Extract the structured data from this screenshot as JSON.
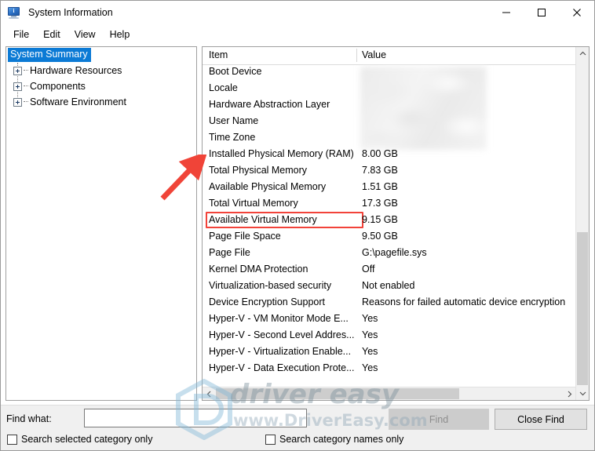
{
  "window": {
    "title": "System Information",
    "icon": "computer-monitor-icon",
    "controls": {
      "minimize": "minimize-icon",
      "maximize": "maximize-icon",
      "close": "close-icon"
    }
  },
  "menubar": {
    "items": [
      {
        "label": "File"
      },
      {
        "label": "Edit"
      },
      {
        "label": "View"
      },
      {
        "label": "Help"
      }
    ]
  },
  "sidebar": {
    "root": {
      "label": "System Summary",
      "selected": true
    },
    "items": [
      {
        "label": "Hardware Resources",
        "expander": "plus-box-icon"
      },
      {
        "label": "Components",
        "expander": "plus-box-icon"
      },
      {
        "label": "Software Environment",
        "expander": "plus-box-icon"
      }
    ]
  },
  "list": {
    "columns": [
      {
        "label": "Item"
      },
      {
        "label": "Value"
      }
    ],
    "rows": [
      {
        "item": "Boot Device",
        "value": "",
        "blurred": true
      },
      {
        "item": "Locale",
        "value": "",
        "blurred": true
      },
      {
        "item": "Hardware Abstraction Layer",
        "value": "",
        "blurred": true
      },
      {
        "item": "User Name",
        "value": "",
        "blurred": true
      },
      {
        "item": "Time Zone",
        "value": "",
        "blurred": true
      },
      {
        "item": "Installed Physical Memory (RAM)",
        "value": "8.00 GB",
        "highlighted": true
      },
      {
        "item": "Total Physical Memory",
        "value": "7.83 GB"
      },
      {
        "item": "Available Physical Memory",
        "value": "1.51 GB"
      },
      {
        "item": "Total Virtual Memory",
        "value": "17.3 GB"
      },
      {
        "item": "Available Virtual Memory",
        "value": "9.15 GB"
      },
      {
        "item": "Page File Space",
        "value": "9.50 GB"
      },
      {
        "item": "Page File",
        "value": "G:\\pagefile.sys"
      },
      {
        "item": "Kernel DMA Protection",
        "value": "Off"
      },
      {
        "item": "Virtualization-based security",
        "value": "Not enabled"
      },
      {
        "item": "Device Encryption Support",
        "value": "Reasons for failed automatic device encryption"
      },
      {
        "item": "Hyper-V - VM Monitor Mode E...",
        "value": "Yes"
      },
      {
        "item": "Hyper-V - Second Level Addres...",
        "value": "Yes"
      },
      {
        "item": "Hyper-V - Virtualization Enable...",
        "value": "Yes"
      },
      {
        "item": "Hyper-V - Data Execution Prote...",
        "value": "Yes"
      }
    ]
  },
  "scrollbars": {
    "vertical": {
      "up_icon": "chevron-up-icon",
      "down_icon": "chevron-down-icon"
    },
    "horizontal": {
      "left_icon": "chevron-left-icon",
      "right_icon": "chevron-right-icon"
    }
  },
  "findbar": {
    "label": "Find what:",
    "input_value": "",
    "input_placeholder": "",
    "find_button": "Find",
    "find_button_enabled": false,
    "close_find_button": "Close Find",
    "checkbox_selected_category": "Search selected category only",
    "checkbox_category_names": "Search category names only"
  },
  "annotations": {
    "arrow": "red-arrow-pointing-up-right",
    "highlight_color": "#f2433a"
  },
  "watermark": {
    "title": "driver easy",
    "url": "www.DriverEasy.com",
    "logo": "driver-easy-hexagon-logo"
  }
}
